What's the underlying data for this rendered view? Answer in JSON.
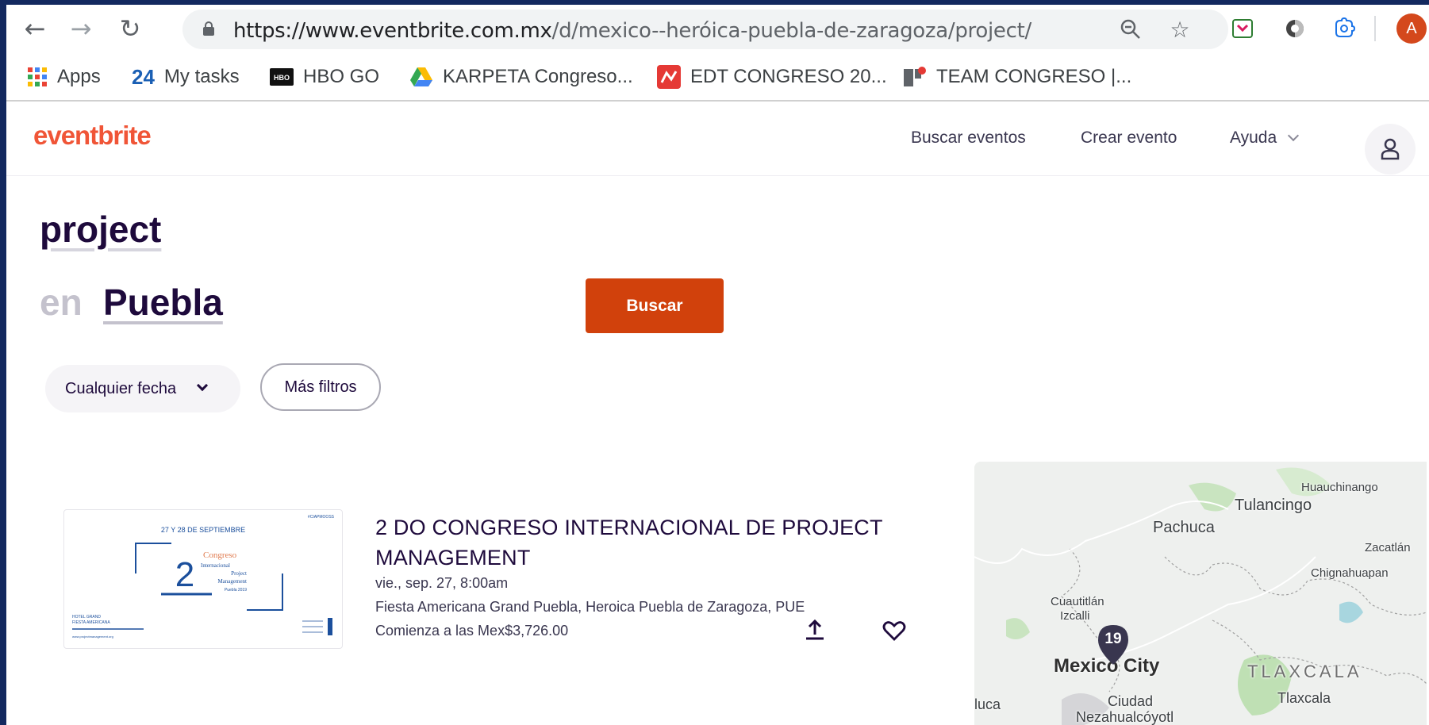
{
  "browser": {
    "url_main": "https://www.eventbrite.com.mx",
    "url_path": "/d/mexico--heróica-puebla-de-zaragoza/project/",
    "profile_initial": "A",
    "bookmarks": [
      {
        "label": "Apps",
        "icon": "apps-grid-icon"
      },
      {
        "label": "My tasks",
        "prefix": "24",
        "icon": "tasks-icon"
      },
      {
        "label": "HBO GO",
        "icon": "hbo-icon"
      },
      {
        "label": "KARPETA Congreso...",
        "icon": "google-drive-icon"
      },
      {
        "label": "EDT CONGRESO 20...",
        "icon": "edt-icon"
      },
      {
        "label": "TEAM CONGRESO |...",
        "icon": "trello-icon"
      }
    ]
  },
  "header": {
    "logo": "eventbrite",
    "nav_find": "Buscar eventos",
    "nav_create": "Crear evento",
    "nav_help": "Ayuda"
  },
  "search": {
    "query": "project",
    "in_label": "en",
    "location": "Puebla",
    "button": "Buscar",
    "date_filter": "Cualquier fecha",
    "more_filters": "Más filtros"
  },
  "event": {
    "title": "2 DO CONGRESO INTERNACIONAL DE PROJECT MANAGEMENT",
    "date": "vie., sep. 27, 8:00am",
    "venue": "Fiesta Americana Grand Puebla, Heroica Puebla de Zaragoza, PUE",
    "price": "Comienza a las Mex$3,726.00",
    "thumb": {
      "dates": "27 Y 28 DE SEPTIEMBRE",
      "hashtag": "#CIAPMOOSS",
      "number": "2",
      "line1": "Congreso",
      "line2": "Internacional",
      "line3": "Project",
      "line4": "Management",
      "line5": "Puebla 2019",
      "venue1": "HOTEL GRAND",
      "venue2": "FIESTA AMERICANA",
      "site": "www.projectmanagement.org"
    }
  },
  "map": {
    "cluster_count": "19",
    "labels": {
      "l1": "Huauchinango",
      "l2": "Tulancingo",
      "l3": "Pachuca",
      "l4": "Zacatlán",
      "l5": "Chignahuapan",
      "l6": "Cuautitlán",
      "l7": "Izcalli",
      "l8": "Mexico City",
      "l9": "TLAXCALA",
      "l10": "Tlaxcala",
      "l11": "Ciudad",
      "l12": "Nezahualcóyotl",
      "l13": "luca"
    }
  },
  "colors": {
    "brand": "#f05537",
    "button": "#d1410c",
    "text_dark": "#1e0a3c"
  }
}
